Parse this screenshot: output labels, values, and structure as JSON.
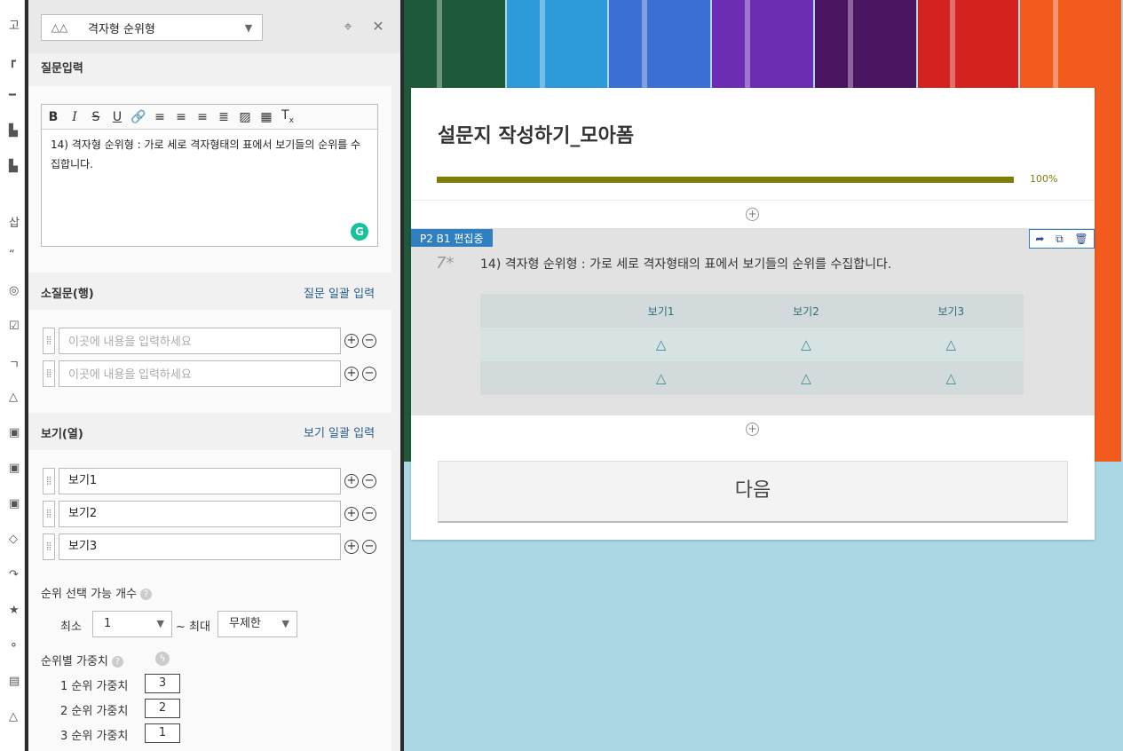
{
  "panel": {
    "type_select": "격자형 순위형",
    "question_input_title": "질문입력",
    "question_text": "14) 격자형 순위형 : 가로 세로 격자형태의 표에서 보기들의 순위를 수집합니다.",
    "subq_title": "소질문(행)",
    "subq_bulk": "질문 일괄 입력",
    "subq_placeholder": "이곳에 내용을 입력하세요",
    "options_title": "보기(열)",
    "options_bulk": "보기 일괄 입력",
    "options": [
      "보기1",
      "보기2",
      "보기3"
    ],
    "rank_count_label": "순위 선택 가능 개수",
    "min_label": "최소",
    "min_value": "1",
    "max_label": "~ 최대",
    "max_value": "무제한",
    "weight_label": "순위별 가중치",
    "weights": [
      {
        "label": "1 순위 가중치",
        "value": "3"
      },
      {
        "label": "2 순위 가중치",
        "value": "2"
      },
      {
        "label": "3 순위 가중치",
        "value": "1"
      }
    ]
  },
  "form": {
    "title": "설문지 작성하기_모아폼",
    "progress_pct": "100%",
    "progress_value": 1.0,
    "badge": "P2 B1 편집중",
    "question_number": "7*",
    "question_text": "14) 격자형 순위형 : 가로 세로 격자형태의 표에서 보기들의 순위를 수집합니다.",
    "columns": [
      "보기1",
      "보기2",
      "보기3"
    ],
    "rows": 2,
    "cell_symbol": "△",
    "next_button": "다음"
  },
  "colors": {
    "progress": "#7e7d05",
    "badge": "#2f7fc1",
    "grammarly": "#15c39a"
  },
  "pencil_colors": [
    "#1e5a3a",
    "#2d9ad9",
    "#3b6fd4",
    "#6b2db3",
    "#4a1560",
    "#d4231f",
    "#f25b1d"
  ]
}
